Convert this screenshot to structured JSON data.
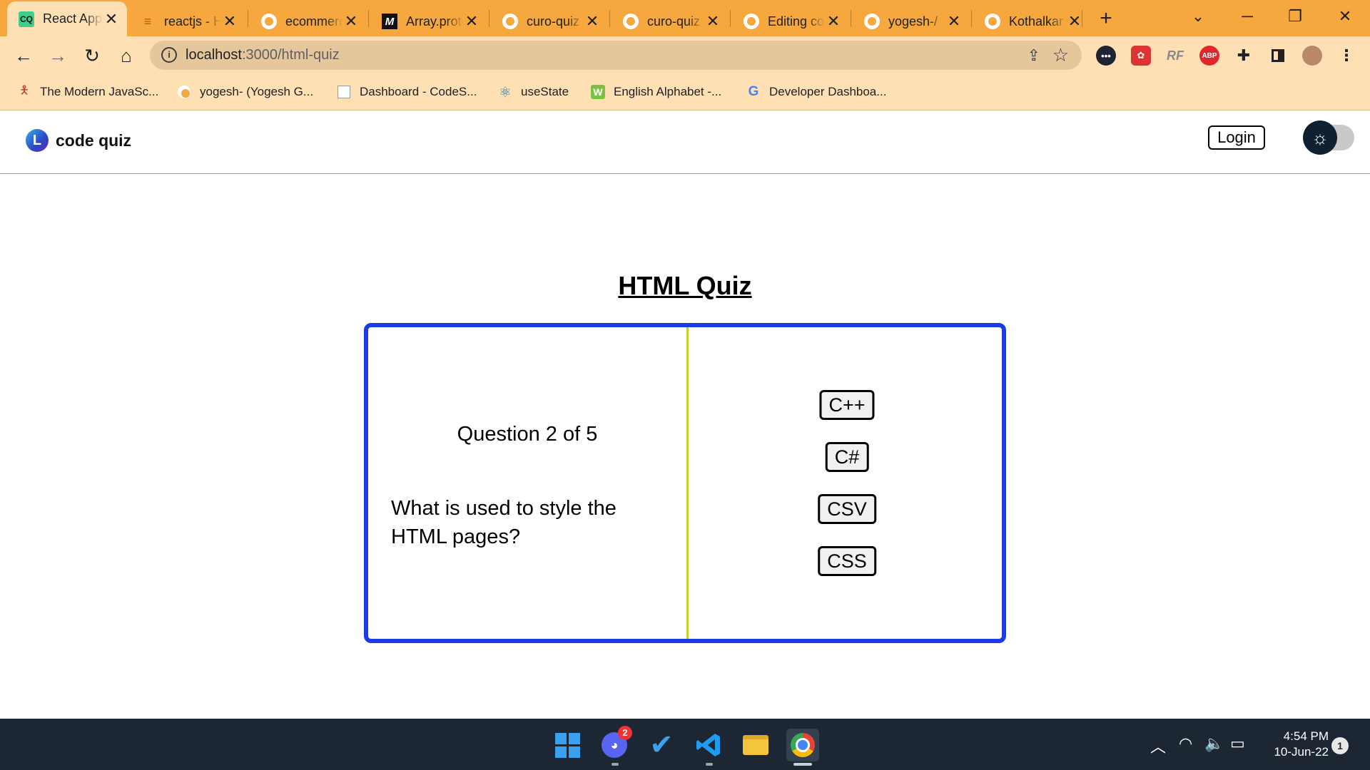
{
  "browser": {
    "tabs": [
      {
        "title": "React App",
        "favicon": "CQ"
      },
      {
        "title": "reactjs - How",
        "favicon": "stackoverflow-icon"
      },
      {
        "title": "ecommerce",
        "favicon": "github-icon"
      },
      {
        "title": "Array.prototype",
        "favicon": "M"
      },
      {
        "title": "curo-quiz",
        "favicon": "github-icon"
      },
      {
        "title": "curo-quiz",
        "favicon": "github-icon"
      },
      {
        "title": "Editing code",
        "favicon": "github-icon"
      },
      {
        "title": "yogesh-/",
        "favicon": "github-icon"
      },
      {
        "title": "Kothalkar",
        "favicon": "github-icon"
      }
    ],
    "url_host": "localhost",
    "url_rest": ":3000/html-quiz",
    "bookmarks": [
      {
        "label": "The Modern JavaSc...",
        "icon": "person-icon"
      },
      {
        "label": "yogesh- (Yogesh G...",
        "icon": "github-icon"
      },
      {
        "label": "Dashboard - CodeS...",
        "icon": "page-icon"
      },
      {
        "label": "useState",
        "icon": "react-icon"
      },
      {
        "label": "English Alphabet -...",
        "icon": "w-icon"
      },
      {
        "label": "Developer Dashboa...",
        "icon": "google-icon"
      }
    ],
    "extensions": {
      "abp": "ABP",
      "rf": "RF"
    }
  },
  "app": {
    "brand_logo": "L",
    "brand_name": "code quiz",
    "login_label": "Login",
    "theme": "light"
  },
  "quiz": {
    "title": "HTML Quiz",
    "counter": "Question 2 of 5",
    "question": "What is used to style the HTML pages?",
    "answers": [
      "C++",
      "C#",
      "CSV",
      "CSS"
    ]
  },
  "taskbar": {
    "time": "4:54 PM",
    "date": "10-Jun-22",
    "discord_badge": "2",
    "notification_count": "1"
  },
  "colors": {
    "tabstrip": "#f6a83f",
    "toolbar": "#ffe0b5",
    "card_border": "#1a3be6",
    "divider": "#c9cf2a",
    "taskbar": "#1c2733"
  }
}
